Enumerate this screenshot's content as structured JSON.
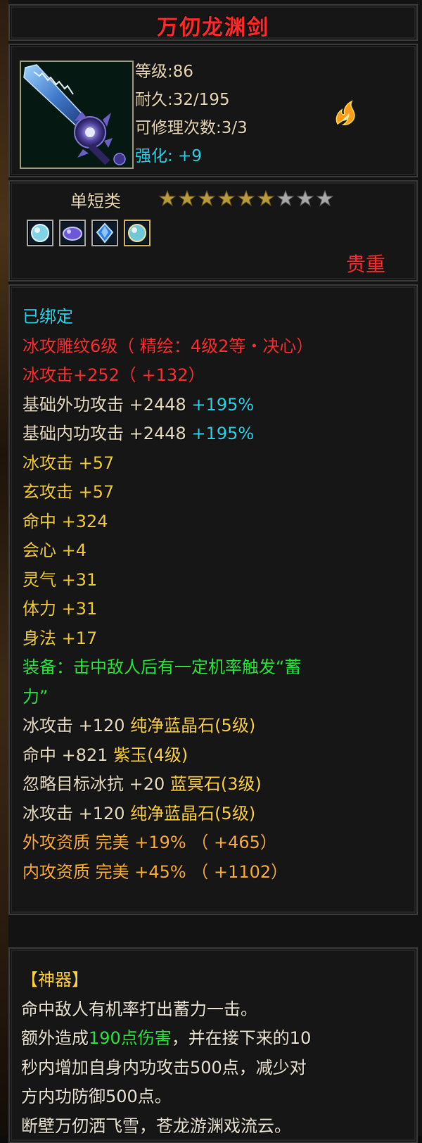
{
  "item": {
    "name": "万仞龙渊剑",
    "level_label": "等级",
    "level_value": ":86",
    "durability_label": "耐久",
    "durability_value": ":32/195",
    "repair_label": "可修理次数",
    "repair_value": ":3/3",
    "enhance_label": "强化",
    "enhance_value": ": +9",
    "category": "单短类",
    "stars_total": 9,
    "stars_filled": 6,
    "gems": [
      "ice-crystal-gem",
      "purple-jade-gem",
      "blue-crystal-gem",
      "gold-ice-gem"
    ],
    "rarity": "贵重"
  },
  "stats": [
    {
      "color": "cyan",
      "text": "已绑定",
      "extra": ""
    },
    {
      "color": "red",
      "text": "冰攻雕纹6级（ 精绘：4级2等・决心）",
      "extra": ""
    },
    {
      "color": "red",
      "text": "冰攻击+252（ +132）",
      "extra": ""
    },
    {
      "color": "white",
      "text": "基础外功攻击 +2448 ",
      "extra": "+195%"
    },
    {
      "color": "white",
      "text": "基础内功攻击 +2448 ",
      "extra": "+195%"
    },
    {
      "color": "yellow",
      "text": "冰攻击 +57",
      "extra": ""
    },
    {
      "color": "yellow",
      "text": "玄攻击 +57",
      "extra": ""
    },
    {
      "color": "yellow",
      "text": "命中 +324",
      "extra": ""
    },
    {
      "color": "yellow",
      "text": "会心 +4",
      "extra": ""
    },
    {
      "color": "yellow",
      "text": "灵气 +31",
      "extra": ""
    },
    {
      "color": "yellow",
      "text": "体力 +31",
      "extra": ""
    },
    {
      "color": "yellow",
      "text": "身法 +17",
      "extra": ""
    },
    {
      "color": "green",
      "text": "装备：击中敌人后有一定机率触发“蓄",
      "extra": ""
    },
    {
      "color": "green",
      "text": "力”",
      "extra": ""
    },
    {
      "color": "white",
      "text": "冰攻击 +120 ",
      "extra": "纯净蓝晶石(5级)"
    },
    {
      "color": "white",
      "text": "命中 +821 ",
      "extra": "紫玉(4级)"
    },
    {
      "color": "white",
      "text": "忽略目标冰抗 +20 ",
      "extra": "蓝冥石(3级)"
    },
    {
      "color": "white",
      "text": "冰攻击 +120 ",
      "extra": "纯净蓝晶石(5级)"
    },
    {
      "color": "orange",
      "text": "外攻资质  完美 +19% （ +465）",
      "extra": ""
    },
    {
      "color": "orange",
      "text": "内攻资质  完美 +45% （ +1102）",
      "extra": ""
    }
  ],
  "artifact": {
    "heading": "【神器】",
    "line1": "命中敌人有机率打出蓄力一击。",
    "line2_pre": "额外造成",
    "line2_hl": "190点伤害",
    "line2_post": "，并在接下来的10",
    "line3": "秒内增加自身内功攻击500点，减少对",
    "line4": "方内功防御500点。",
    "line5": "断壁万仞洒飞雪，苍龙游渊戏流云。"
  },
  "colors": {
    "red": "#ff2e2e",
    "yellow": "#f2cc2e",
    "cyan": "#22d6ee",
    "green": "#27e63a",
    "white": "#e8dcc0",
    "orange": "#ffae2e"
  }
}
